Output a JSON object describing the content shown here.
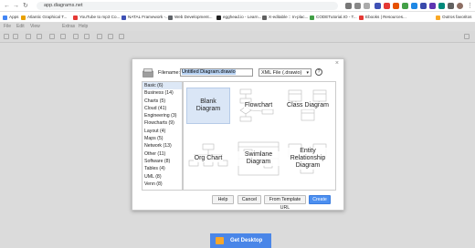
{
  "browser": {
    "url": "app.diagrams.net",
    "bookmarks": [
      {
        "label": "Apps",
        "color": "#4285f4"
      },
      {
        "label": "Atlantic Graphical T...",
        "color": "#e8a000"
      },
      {
        "label": "YouTube to mp3 Co...",
        "color": "#e53935"
      },
      {
        "label": "NATAL Framework -...",
        "color": "#3f51b5"
      },
      {
        "label": "Web Development...",
        "color": "#5f6368"
      },
      {
        "label": "egghead.io - Learn...",
        "color": "#222222"
      },
      {
        "label": "X-editable :: In-plac...",
        "color": "#616161"
      },
      {
        "label": "CODETutorial.IO - T...",
        "color": "#43a047"
      },
      {
        "label": "Ebooks | Resources...",
        "color": "#e53935"
      },
      {
        "label": "Outros favoritos",
        "color": "#f9a825"
      }
    ]
  },
  "app": {
    "menus": [
      "File",
      "Edit",
      "View",
      "Extras",
      "Help"
    ],
    "get_desktop_label": "Get Desktop"
  },
  "dialog": {
    "close_label": "×",
    "filename_label": "Filename:",
    "filename_value": "Untitled Diagram.drawio",
    "format_value": "XML File (.drawio)",
    "help_icon": "?",
    "categories": [
      "Basic (6)",
      "Business (14)",
      "Charts (5)",
      "Cloud (41)",
      "Engineering (3)",
      "Flowcharts (9)",
      "Layout (4)",
      "Maps (5)",
      "Network (13)",
      "Other (11)",
      "Software (8)",
      "Tables (4)",
      "UML (8)",
      "Venn (8)"
    ],
    "selected_category": "Basic (6)",
    "templates": [
      "Blank Diagram",
      "Flowchart",
      "Class Diagram",
      "Org Chart",
      "Swimlane Diagram",
      "Entity Relationship Diagram"
    ],
    "selected_template": "Blank Diagram",
    "buttons": {
      "help": "Help",
      "cancel": "Cancel",
      "from_template_url": "From Template URL",
      "create": "Create"
    }
  }
}
